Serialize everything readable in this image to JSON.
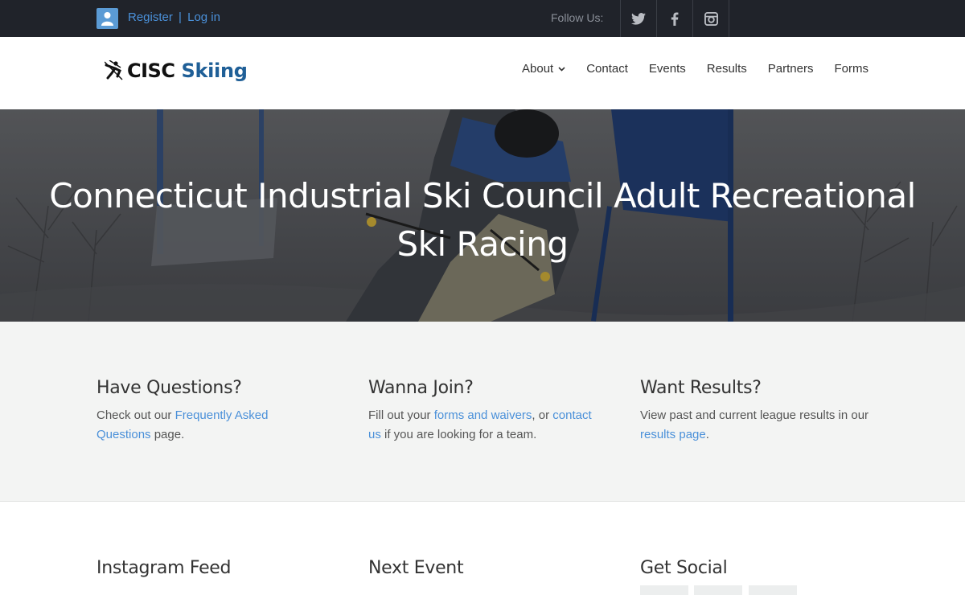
{
  "topbar": {
    "register_label": "Register",
    "separator": "|",
    "login_label": "Log in",
    "follow_label": "Follow Us:",
    "social_icons": [
      "twitter-icon",
      "facebook-icon",
      "instagram-icon"
    ]
  },
  "header": {
    "logo_text_main": "CISC",
    "logo_text_accent": "Skiing",
    "nav": [
      {
        "label": "About",
        "has_dropdown": true
      },
      {
        "label": "Contact"
      },
      {
        "label": "Events"
      },
      {
        "label": "Results"
      },
      {
        "label": "Partners"
      },
      {
        "label": "Forms"
      }
    ]
  },
  "hero": {
    "title_line1": "Connecticut Industrial Ski Council Adult Recreational",
    "title_line2": "Ski Racing"
  },
  "info": {
    "questions": {
      "heading": "Have Questions?",
      "text_before": "Check out our ",
      "link": "Frequently Asked Questions",
      "text_after": " page."
    },
    "join": {
      "heading": "Wanna Join?",
      "text_before": "Fill out your ",
      "link1": "forms and waivers",
      "text_mid": ", or ",
      "link2": "contact us",
      "text_after": " if you are looking for a team."
    },
    "results": {
      "heading": "Want Results?",
      "text_before": "View past and current league results in our ",
      "link": "results page",
      "text_after": "."
    }
  },
  "lower": {
    "instagram_heading": "Instagram Feed",
    "event_heading": "Next Event",
    "social_heading": "Get Social"
  },
  "colors": {
    "topbar": "#20232a",
    "link": "#4a90d9",
    "logo_accent": "#1f5f97",
    "info_bg": "#f3f4f3"
  }
}
